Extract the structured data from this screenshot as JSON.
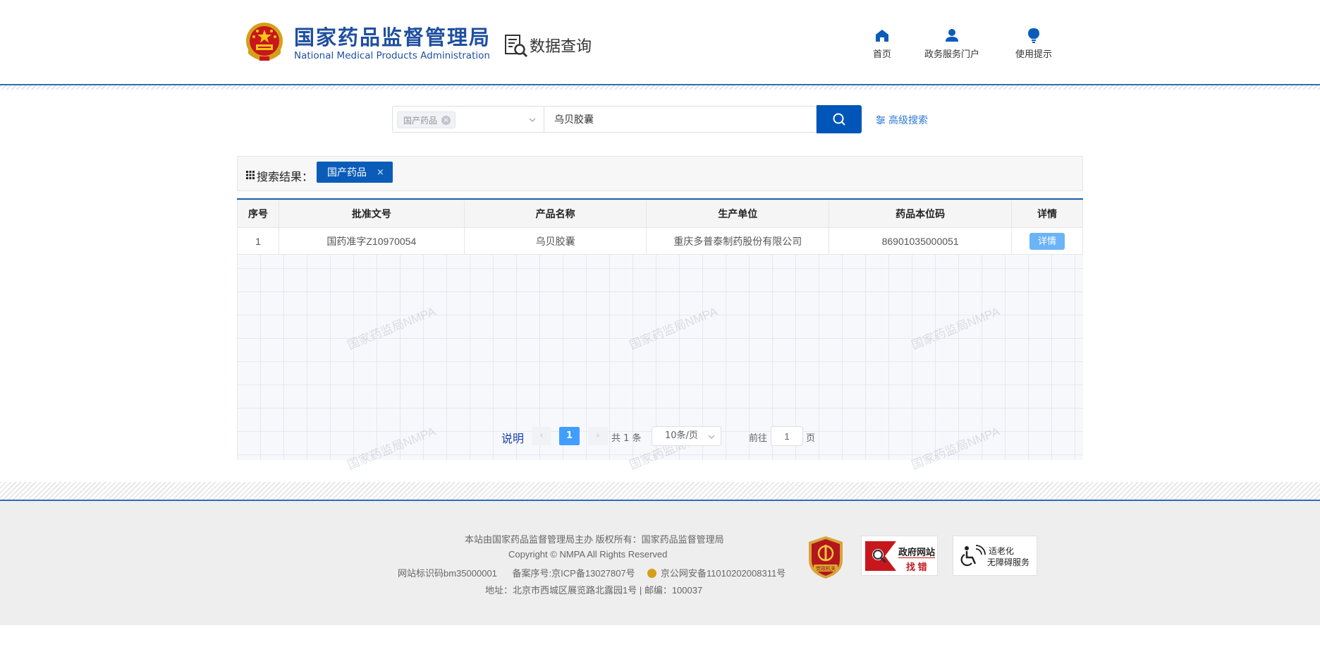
{
  "header": {
    "brand_cn": "国家药品监督管理局",
    "brand_en": "National Medical Products Administration",
    "section_title": "数据查询",
    "nav": [
      {
        "label": "首页",
        "icon": "home-icon"
      },
      {
        "label": "政务服务门户",
        "icon": "user-icon"
      },
      {
        "label": "使用提示",
        "icon": "lightbulb-icon"
      }
    ]
  },
  "search": {
    "category_tag": "国产药品",
    "query_value": "乌贝胶囊",
    "advanced_label": "高级搜索",
    "button_icon": "search-icon"
  },
  "results": {
    "label": "搜索结果：",
    "filter_chip": "国产药品",
    "table": {
      "columns": [
        "序号",
        "批准文号",
        "产品名称",
        "生产单位",
        "药品本位码",
        "详情"
      ],
      "rows": [
        {
          "index": "1",
          "approval_no": "国药准字Z10970054",
          "product_name": "乌贝胶囊",
          "manufacturer": "重庆多普泰制药股份有限公司",
          "drug_code": "86901035000051",
          "detail_label": "详情"
        }
      ]
    },
    "watermark": "国家药监局NMPA"
  },
  "pagination": {
    "note_label": "说明",
    "prev_icon": "‹",
    "next_icon": "›",
    "current_page": "1",
    "total_text": "共 1 条",
    "page_size": "10条/页",
    "goto_prefix": "前往",
    "goto_value": "1",
    "goto_suffix": "页"
  },
  "footer": {
    "line1": "本站由国家药品监督管理局主办 版权所有：国家药品监督管理局",
    "line2": "Copyright © NMPA All Rights Reserved",
    "site_code": "网站标识码bm35000001",
    "icp": "备案序号:京ICP备13027807号",
    "police": "京公网安备11010202008311号",
    "address": "地址：北京市西城区展览路北露园1号 | 邮编：100037",
    "badge_party": "党政机关",
    "badge_report_title": "政府网站",
    "badge_report_sub": "找 错",
    "badge_access_1": "适老化",
    "badge_access_2": "无障碍服务"
  },
  "colors": {
    "brand_blue": "#1f4fa0",
    "primary_button": "#0056b8",
    "detail_button": "#6bb4f6",
    "pager_active": "#409eff"
  }
}
